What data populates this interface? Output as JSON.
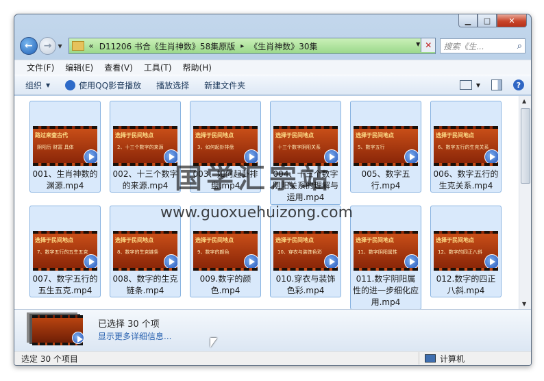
{
  "window": {
    "min_icon": "minimize-icon",
    "max_icon": "maximize-icon",
    "close_icon": "close-icon"
  },
  "address": {
    "prefix": "«",
    "crumbs": [
      "D11206 书合《生肖神数》58集原版",
      "《生肖神数》30集"
    ],
    "separator": "▸"
  },
  "search": {
    "placeholder": "搜索《生..."
  },
  "menu": [
    "文件(F)",
    "编辑(E)",
    "查看(V)",
    "工具(T)",
    "帮助(H)"
  ],
  "toolbar": {
    "organize": "组织",
    "qq_play": "使用QQ影音播放",
    "play_selection": "播放选择",
    "new_folder": "新建文件夹"
  },
  "files": [
    {
      "name": "001、生肖神数的渊源.mp4",
      "thumb_title": "路过来查古代",
      "thumb_sub": "阴阳历 财富 具体"
    },
    {
      "name": "002、十三个数字的来源.mp4",
      "thumb_title": "选择于民间地点",
      "thumb_sub": "2、十三个数字的来源"
    },
    {
      "name": "003、如何起卦排盘.mp4",
      "thumb_title": "选择于民间地点",
      "thumb_sub": "3、如何起卦排盘"
    },
    {
      "name": "004、十三个数字阴阳关系的理解与运用.mp4",
      "thumb_title": "选择于民间地点",
      "thumb_sub": "十三个数字阴阳关系"
    },
    {
      "name": "005、数字五行.mp4",
      "thumb_title": "选择于民间地点",
      "thumb_sub": "5、数字五行"
    },
    {
      "name": "006、数字五行的生克关系.mp4",
      "thumb_title": "选择于民间地点",
      "thumb_sub": "6、数字五行的生克关系"
    },
    {
      "name": "007、数字五行的五生五克.mp4",
      "thumb_title": "选择于民间地点",
      "thumb_sub": "7、数字五行的五生五克"
    },
    {
      "name": "008、数字的生克链条.mp4",
      "thumb_title": "选择于民间地点",
      "thumb_sub": "8、数字的生克链条"
    },
    {
      "name": "009.数字的颜色.mp4",
      "thumb_title": "选择于民间地点",
      "thumb_sub": "9、数字的颜色"
    },
    {
      "name": "010.穿衣与装饰色彩.mp4",
      "thumb_title": "选择于民间地点",
      "thumb_sub": "10、穿衣与装饰色彩"
    },
    {
      "name": "011.数字阴阳属性的进一步细化应用.mp4",
      "thumb_title": "选择于民间地点",
      "thumb_sub": "11、数字阴阳属性"
    },
    {
      "name": "012.数字的四正八斜.mp4",
      "thumb_title": "选择于民间地点",
      "thumb_sub": "12、数字的四正八斜"
    }
  ],
  "details": {
    "selected": "已选择 30 个项",
    "more": "显示更多详细信息..."
  },
  "status": {
    "left": "选定 30 个项目",
    "right": "计算机"
  },
  "watermark": {
    "cn": "国学汇宗站",
    "url": "www.guoxuehuizong.com"
  }
}
